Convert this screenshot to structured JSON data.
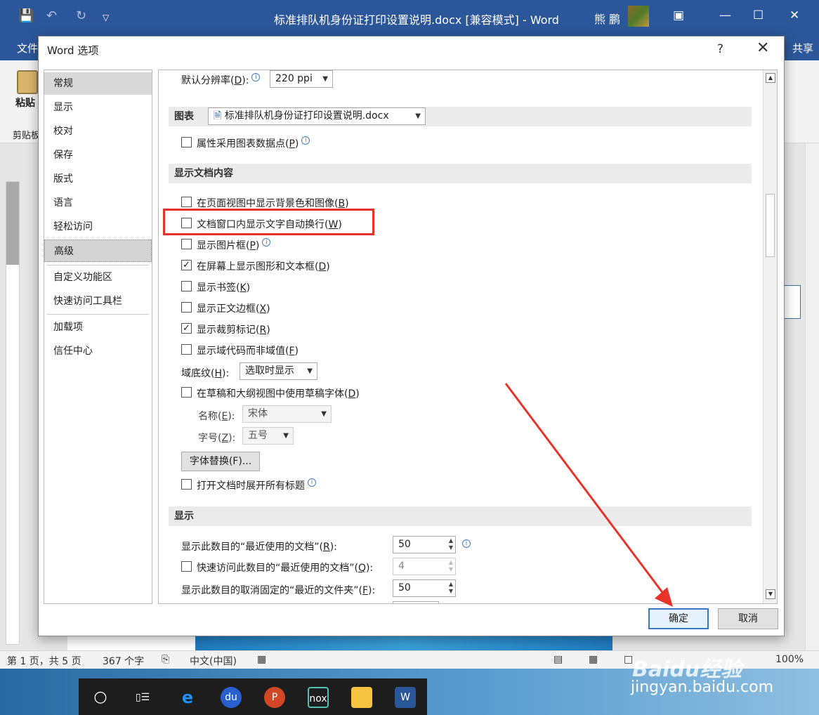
{
  "window": {
    "title": "标准排队机身份证打印设置说明.docx [兼容模式] - Word",
    "user": "熊 鹏",
    "file_tab": "文件",
    "share_tab": "共享"
  },
  "ribbon": {
    "paste": "粘贴",
    "clipboard": "剪贴板"
  },
  "status_bar": {
    "page": "第 1 页，共 5 页",
    "words": "367 个字",
    "language": "中文(中国)",
    "zoom": "100%"
  },
  "taskbar": {
    "watermark_main": "Baidu经验",
    "watermark_url": "jingyan.baidu.com",
    "apps": [
      "cortana",
      "task-view",
      "edge",
      "baidu",
      "powerpoint",
      "nox",
      "file-explorer",
      "word"
    ]
  },
  "dialog": {
    "title": "Word 选项",
    "help": "?",
    "close": "✕",
    "nav": [
      "常规",
      "显示",
      "校对",
      "保存",
      "版式",
      "语言",
      "轻松访问",
      "高级",
      "自定义功能区",
      "快速访问工具栏",
      "加载项",
      "信任中心"
    ],
    "selected_nav": "高级",
    "content": {
      "resolution_label": "默认分辨率(",
      "resolution_key": "D",
      "resolution_suffix": "):",
      "resolution_value": "220 ppi",
      "chart_section": "图表",
      "chart_doc": "标准排队机身份证打印设置说明.docx",
      "chart_datapoint_label": "属性采用图表数据点(",
      "chart_datapoint_key": "P",
      "chart_datapoint_suffix": ")",
      "display_doc_section": "显示文档内容",
      "options": [
        {
          "label": "在页面视图中显示背景色和图像(",
          "key": "B",
          "suffix": ")",
          "checked": false
        },
        {
          "label": "文档窗口内显示文字自动换行(",
          "key": "W",
          "suffix": ")",
          "checked": false
        },
        {
          "label": "显示图片框(",
          "key": "P",
          "suffix": ")",
          "checked": false
        },
        {
          "label": "在屏幕上显示图形和文本框(",
          "key": "D",
          "suffix": ")",
          "checked": true
        },
        {
          "label": "显示书签(",
          "key": "K",
          "suffix": ")",
          "checked": false
        },
        {
          "label": "显示正文边框(",
          "key": "X",
          "suffix": ")",
          "checked": false
        },
        {
          "label": "显示裁剪标记(",
          "key": "R",
          "suffix": ")",
          "checked": true
        },
        {
          "label": "显示域代码而非域值(",
          "key": "F",
          "suffix": ")",
          "checked": false
        }
      ],
      "field_shading_label": "域底纹(",
      "field_shading_key": "H",
      "field_shading_suffix": "):",
      "field_shading_value": "选取时显示",
      "draft_font_label": "在草稿和大纲视图中使用草稿字体(",
      "draft_font_key": "D",
      "draft_font_suffix": ")",
      "font_name_label": "名称(",
      "font_name_key": "E",
      "font_name_suffix": "):",
      "font_name_value": "宋体",
      "font_size_label": "字号(",
      "font_size_key": "Z",
      "font_size_suffix": "):",
      "font_size_value": "五号",
      "font_subst_button": "字体替换(F)...",
      "expand_headings_label": "打开文档时展开所有标题",
      "display_section": "显示",
      "recent_docs_label": "显示此数目的“最近使用的文档”(",
      "recent_docs_key": "R",
      "recent_docs_suffix": "):",
      "recent_docs_value": "50",
      "quick_access_label": "快速访问此数目的“最近使用的文档”(",
      "quick_access_key": "Q",
      "quick_access_suffix": "):",
      "quick_access_value": "4",
      "recent_folders_label": "显示此数目的取消固定的“最近的文件夹”(",
      "recent_folders_key": "F",
      "recent_folders_suffix": "):",
      "recent_folders_value": "50"
    },
    "ok": "确定",
    "cancel": "取消"
  },
  "annotations": {
    "highlight_color": "#e8332a",
    "arrow_color": "#e8332a"
  }
}
